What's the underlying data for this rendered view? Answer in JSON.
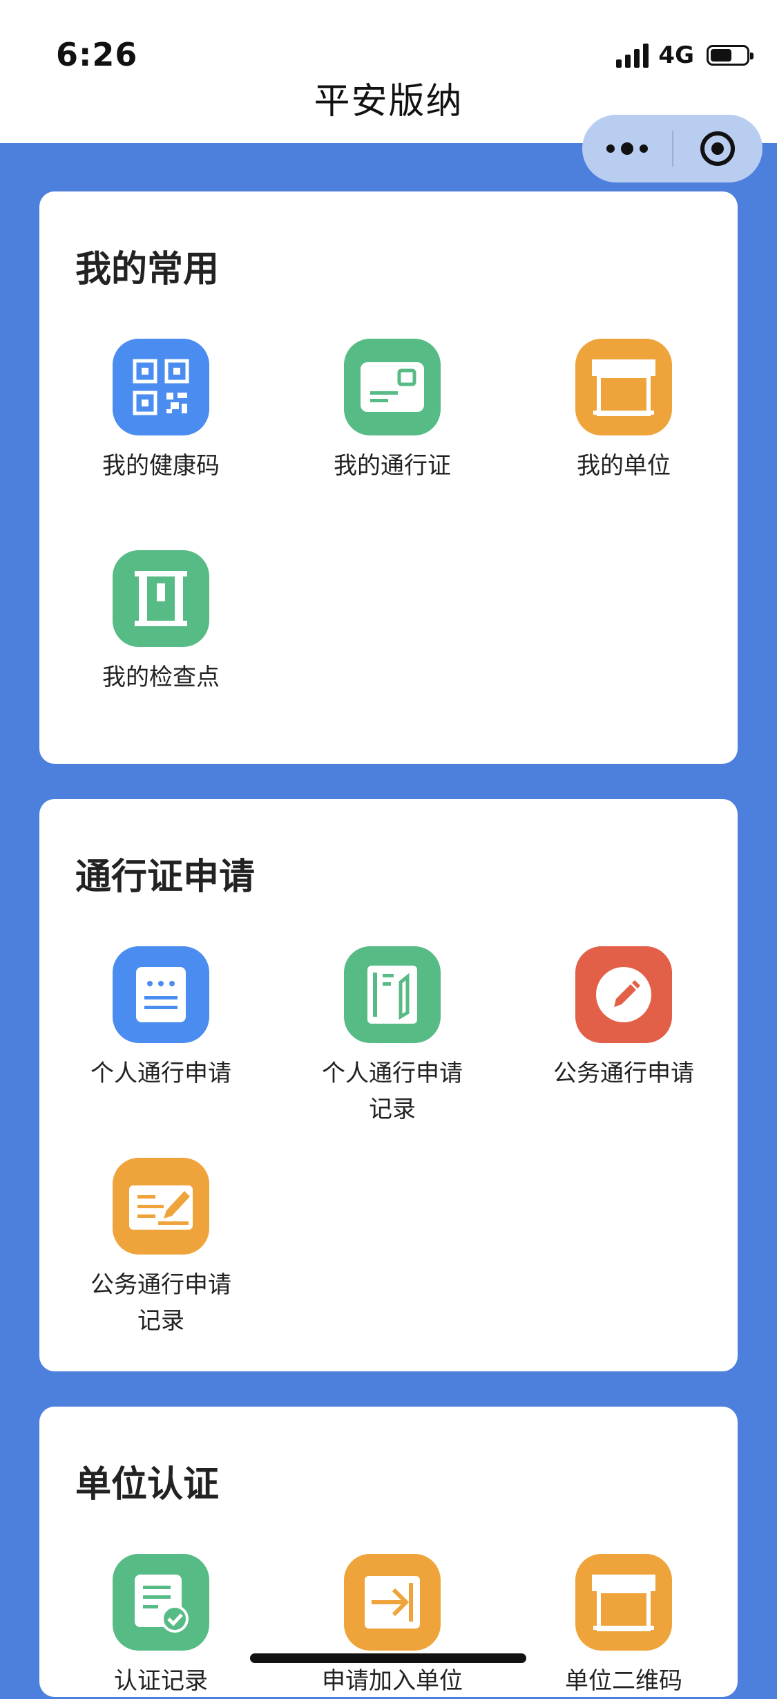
{
  "status": {
    "time": "6:26",
    "network": "4G"
  },
  "header": {
    "title": "平安版纳"
  },
  "colors": {
    "background": "#4d7fdd",
    "blue": "#4a8cf0",
    "green": "#57bb85",
    "orange": "#efa43b",
    "red": "#e25f48"
  },
  "sections": [
    {
      "title": "我的常用",
      "items": [
        {
          "label": "我的健康码",
          "icon": "qr-code-icon",
          "color": "blue"
        },
        {
          "label": "我的通行证",
          "icon": "pass-card-icon",
          "color": "green"
        },
        {
          "label": "我的单位",
          "icon": "storefront-icon",
          "color": "orange"
        },
        {
          "label": "我的检查点",
          "icon": "checkpoint-gate-icon",
          "color": "green"
        }
      ]
    },
    {
      "title": "通行证申请",
      "items": [
        {
          "label": "个人通行申请",
          "icon": "document-icon",
          "color": "blue"
        },
        {
          "label": "个人通行申请\n记录",
          "icon": "notebook-pen-icon",
          "color": "green"
        },
        {
          "label": "公务通行申请",
          "icon": "pencil-icon",
          "color": "red"
        },
        {
          "label": "公务通行申请\n记录",
          "icon": "writing-board-icon",
          "color": "orange"
        }
      ]
    },
    {
      "title": "单位认证",
      "items": [
        {
          "label": "认证记录",
          "icon": "verified-record-icon",
          "color": "green"
        },
        {
          "label": "申请加入单位",
          "icon": "join-arrow-icon",
          "color": "orange"
        },
        {
          "label": "单位二维码",
          "icon": "storefront-icon",
          "color": "orange"
        }
      ]
    }
  ]
}
